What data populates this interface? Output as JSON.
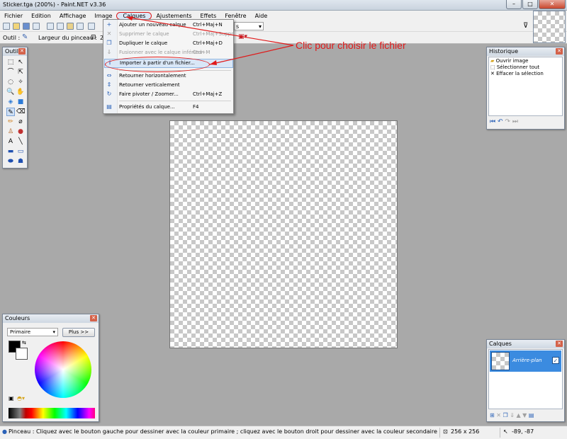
{
  "window": {
    "title": "Sticker.tga (200%) - Paint.NET v3.36",
    "min": "–",
    "max": "□",
    "close": "✕"
  },
  "menu": [
    "Fichier",
    "Edition",
    "Affichage",
    "Image",
    "Calques",
    "Ajustements",
    "Effets",
    "Fenêtre",
    "Aide"
  ],
  "toolbar": {
    "outil_label": "Outil :",
    "brush_width_label": "Largeur du pinceau :",
    "brush_width_value": "2",
    "dropdown_fragment": "s"
  },
  "layers_menu": {
    "items": [
      {
        "label": "Ajouter un nouveau calque",
        "shortcut": "Ctrl+Maj+N",
        "icon": "+",
        "disabled": false
      },
      {
        "label": "Supprimer le calque",
        "shortcut": "Ctrl+Maj+Suppr",
        "icon": "✕",
        "disabled": true
      },
      {
        "label": "Dupliquer le calque",
        "shortcut": "Ctrl+Maj+D",
        "icon": "❐",
        "disabled": false
      },
      {
        "label": "Fusionner avec le calque inférieur",
        "shortcut": "Ctrl+M",
        "icon": "⇓",
        "disabled": true
      },
      {
        "label": "Importer à partir d'un fichier...",
        "shortcut": "",
        "icon": "⇪",
        "disabled": false
      },
      {
        "label": "Retourner horizontalement",
        "shortcut": "",
        "icon": "⇔",
        "disabled": false
      },
      {
        "label": "Retourner verticalement",
        "shortcut": "",
        "icon": "⇕",
        "disabled": false
      },
      {
        "label": "Faire pivoter / Zoomer...",
        "shortcut": "Ctrl+Maj+Z",
        "icon": "↻",
        "disabled": false
      },
      {
        "label": "Propriétés du calque...",
        "shortcut": "F4",
        "icon": "▤",
        "disabled": false
      }
    ]
  },
  "annotation": "Clic pour choisir le fichier",
  "tools_panel": {
    "title": "Outils"
  },
  "history_panel": {
    "title": "Historique",
    "items": [
      "Ouvrir image",
      "Sélectionner tout",
      "Effacer la sélection"
    ]
  },
  "colors_panel": {
    "title": "Couleurs",
    "mode": "Primaire",
    "more_button": "Plus >>"
  },
  "layers_panel": {
    "title": "Calques",
    "layer_name": "Arrière-plan"
  },
  "statusbar": {
    "hint": "Pinceau : Cliquez avec le bouton gauche pour dessiner avec la couleur primaire ; cliquez avec le bouton droit pour dessiner avec la couleur secondaire",
    "size": "256 x 256",
    "coords": "-89, -87"
  },
  "colors": {
    "accent": "#e01a1a",
    "selection": "#3b8be0",
    "menu_highlight": "#d9e7f7"
  }
}
